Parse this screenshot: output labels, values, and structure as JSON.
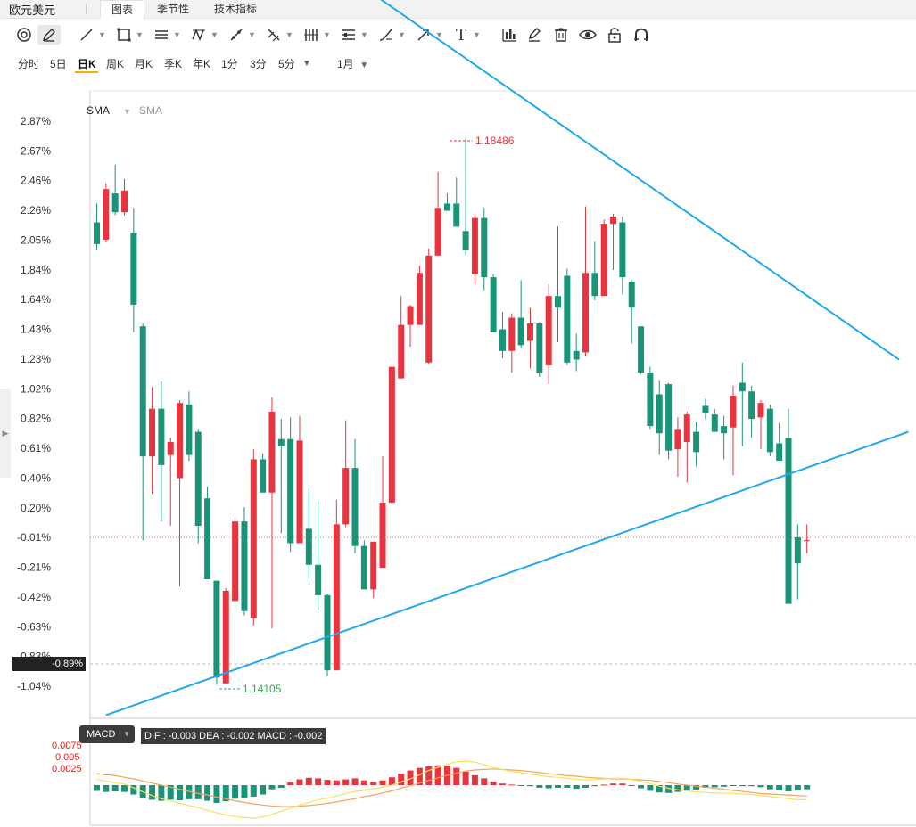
{
  "header": {
    "title": "欧元美元",
    "tabs": [
      {
        "label": "图表",
        "active": true
      },
      {
        "label": "季节性",
        "active": false
      },
      {
        "label": "技术指标",
        "active": false
      }
    ]
  },
  "toolbar": {
    "tools": [
      "loop-icon",
      "pencil-icon",
      "line-tool-icon",
      "rectangle-tool-icon",
      "parallel-lines-icon",
      "zigzag-icon",
      "ruler-icon",
      "fibonacci-icon",
      "bar-pattern-icon",
      "channel-icon",
      "brush-icon",
      "arrow-icon",
      "text-tool-icon",
      "candle-chart-icon",
      "edit-icon",
      "trash-icon",
      "eye-icon",
      "lock-icon",
      "magnet-icon"
    ],
    "text_tool_label": "T"
  },
  "periods": {
    "items": [
      "分时",
      "5日",
      "日K",
      "周K",
      "月K",
      "季K",
      "年K",
      "1分",
      "3分",
      "5分"
    ],
    "selected": "日K",
    "range_label": "1月"
  },
  "chart": {
    "sma_legend": [
      "SMA",
      "SMA"
    ],
    "crosshair_value": "-0.89%",
    "high_label": "1.18486",
    "low_label": "1.14105",
    "colors": {
      "up": "#e8343f",
      "down": "#1a9478",
      "trendline": "#1fa8ef",
      "accent": "#f2b300"
    }
  },
  "chart_data": {
    "type": "candlestick",
    "y_axis_ticks": [
      "2.87%",
      "2.67%",
      "2.46%",
      "2.26%",
      "2.05%",
      "1.84%",
      "1.64%",
      "1.43%",
      "1.23%",
      "1.02%",
      "0.82%",
      "0.61%",
      "0.40%",
      "0.20%",
      "-0.01%",
      "-0.21%",
      "-0.42%",
      "-0.63%",
      "-0.83%",
      "-1.04%"
    ],
    "candles": [
      {
        "o": 2.17,
        "c": 2.02,
        "h": 2.3,
        "l": 1.98
      },
      {
        "o": 2.05,
        "c": 2.4,
        "h": 2.44,
        "l": 2.03
      },
      {
        "o": 2.37,
        "c": 2.24,
        "h": 2.57,
        "l": 2.22
      },
      {
        "o": 2.24,
        "c": 2.39,
        "h": 2.47,
        "l": 2.22
      },
      {
        "o": 2.1,
        "c": 1.6,
        "h": 2.27,
        "l": 1.41
      },
      {
        "o": 1.45,
        "c": 0.55,
        "h": 1.47,
        "l": -0.03
      },
      {
        "o": 0.55,
        "c": 0.88,
        "h": 1.03,
        "l": 0.29
      },
      {
        "o": 0.88,
        "c": 0.49,
        "h": 1.07,
        "l": 0.1
      },
      {
        "o": 0.56,
        "c": 0.65,
        "h": 0.68,
        "l": 0.07
      },
      {
        "o": 0.4,
        "c": 0.92,
        "h": 0.94,
        "l": -0.35
      },
      {
        "o": 0.91,
        "c": 0.56,
        "h": 1.0,
        "l": 0.52
      },
      {
        "o": 0.72,
        "c": 0.07,
        "h": 0.74,
        "l": -0.05
      },
      {
        "o": 0.26,
        "c": -0.3,
        "h": 0.34,
        "l": -0.3
      },
      {
        "o": -0.31,
        "c": -0.98,
        "h": -0.31,
        "l": -1.03
      },
      {
        "o": -1.02,
        "c": -0.38,
        "h": -0.36,
        "l": -1.02
      },
      {
        "o": -0.45,
        "c": 0.1,
        "h": 0.13,
        "l": -0.45
      },
      {
        "o": 0.1,
        "c": -0.52,
        "h": 0.2,
        "l": -0.55
      },
      {
        "o": -0.57,
        "c": 0.53,
        "h": 0.6,
        "l": -0.62
      },
      {
        "o": 0.53,
        "c": 0.3,
        "h": 0.57,
        "l": 0.3
      },
      {
        "o": 0.3,
        "c": 0.86,
        "h": 0.96,
        "l": -0.64
      },
      {
        "o": 0.67,
        "c": 0.62,
        "h": 0.81,
        "l": 0.02
      },
      {
        "o": 0.67,
        "c": -0.05,
        "h": 0.82,
        "l": -0.11
      },
      {
        "o": -0.05,
        "c": 0.66,
        "h": 0.83,
        "l": -0.01
      },
      {
        "o": 0.05,
        "c": -0.2,
        "h": 0.33,
        "l": -0.3
      },
      {
        "o": -0.2,
        "c": -0.41,
        "h": 0.24,
        "l": -0.51
      },
      {
        "o": -0.41,
        "c": -0.93,
        "h": -0.4,
        "l": -0.97
      },
      {
        "o": -0.93,
        "c": 0.08,
        "h": 0.25,
        "l": -0.93
      },
      {
        "o": 0.08,
        "c": 0.47,
        "h": 0.8,
        "l": 0.06
      },
      {
        "o": 0.47,
        "c": -0.07,
        "h": 0.67,
        "l": -0.12
      },
      {
        "o": -0.07,
        "c": -0.37,
        "h": -0.03,
        "l": -0.37
      },
      {
        "o": -0.37,
        "c": -0.04,
        "h": -0.04,
        "l": -0.43
      },
      {
        "o": -0.22,
        "c": 0.23,
        "h": 0.55,
        "l": -0.22
      },
      {
        "o": 0.23,
        "c": 1.17,
        "h": 1.17,
        "l": 0.22
      },
      {
        "o": 1.09,
        "c": 1.46,
        "h": 1.66,
        "l": 1.09
      },
      {
        "o": 1.46,
        "c": 1.59,
        "h": 1.6,
        "l": 1.31
      },
      {
        "o": 1.46,
        "c": 1.82,
        "h": 1.87,
        "l": 1.46
      },
      {
        "o": 1.2,
        "c": 1.94,
        "h": 1.99,
        "l": 1.19
      },
      {
        "o": 1.94,
        "c": 2.27,
        "h": 2.52,
        "l": 1.94
      },
      {
        "o": 2.3,
        "c": 2.25,
        "h": 2.37,
        "l": 2.25
      },
      {
        "o": 2.3,
        "c": 2.14,
        "h": 2.48,
        "l": 2.14
      },
      {
        "o": 2.11,
        "c": 1.98,
        "h": 2.75,
        "l": 1.94
      },
      {
        "o": 1.81,
        "c": 2.2,
        "h": 2.23,
        "l": 1.74
      },
      {
        "o": 2.2,
        "c": 1.79,
        "h": 2.27,
        "l": 1.7
      },
      {
        "o": 1.79,
        "c": 1.41,
        "h": 1.81,
        "l": 1.41
      },
      {
        "o": 1.43,
        "c": 1.28,
        "h": 1.55,
        "l": 1.23
      },
      {
        "o": 1.28,
        "c": 1.51,
        "h": 1.54,
        "l": 1.13
      },
      {
        "o": 1.51,
        "c": 1.32,
        "h": 1.77,
        "l": 1.3
      },
      {
        "o": 1.35,
        "c": 1.47,
        "h": 1.58,
        "l": 1.16
      },
      {
        "o": 1.47,
        "c": 1.13,
        "h": 1.48,
        "l": 1.1
      },
      {
        "o": 1.18,
        "c": 1.66,
        "h": 1.74,
        "l": 1.05
      },
      {
        "o": 1.66,
        "c": 1.58,
        "h": 2.14,
        "l": 1.34
      },
      {
        "o": 1.8,
        "c": 1.2,
        "h": 1.85,
        "l": 1.18
      },
      {
        "o": 1.28,
        "c": 1.22,
        "h": 1.4,
        "l": 1.14
      },
      {
        "o": 1.27,
        "c": 1.82,
        "h": 2.28,
        "l": 1.24
      },
      {
        "o": 1.82,
        "c": 1.66,
        "h": 2.04,
        "l": 1.63
      },
      {
        "o": 1.66,
        "c": 2.16,
        "h": 2.19,
        "l": 1.66
      },
      {
        "o": 2.16,
        "c": 2.21,
        "h": 2.23,
        "l": 1.84
      },
      {
        "o": 2.17,
        "c": 1.79,
        "h": 2.21,
        "l": 1.67
      },
      {
        "o": 1.76,
        "c": 1.58,
        "h": 1.77,
        "l": 1.33
      },
      {
        "o": 1.45,
        "c": 1.13,
        "h": 1.45,
        "l": 1.12
      },
      {
        "o": 1.13,
        "c": 0.76,
        "h": 1.17,
        "l": 0.74
      },
      {
        "o": 0.98,
        "c": 0.71,
        "h": 1.08,
        "l": 0.56
      },
      {
        "o": 1.05,
        "c": 0.59,
        "h": 1.06,
        "l": 0.53
      },
      {
        "o": 0.6,
        "c": 0.74,
        "h": 0.82,
        "l": 0.41
      },
      {
        "o": 0.65,
        "c": 0.84,
        "h": 0.86,
        "l": 0.37
      },
      {
        "o": 0.72,
        "c": 0.58,
        "h": 0.79,
        "l": 0.48
      },
      {
        "o": 0.9,
        "c": 0.85,
        "h": 0.95,
        "l": 0.81
      },
      {
        "o": 0.84,
        "c": 0.72,
        "h": 0.88,
        "l": 0.73
      },
      {
        "o": 0.76,
        "c": 0.71,
        "h": 0.83,
        "l": 0.53
      },
      {
        "o": 0.75,
        "c": 0.97,
        "h": 1.04,
        "l": 0.42
      },
      {
        "o": 1.06,
        "c": 1.0,
        "h": 1.2,
        "l": 0.62
      },
      {
        "o": 1.0,
        "c": 0.81,
        "h": 1.04,
        "l": 0.68
      },
      {
        "o": 0.82,
        "c": 0.92,
        "h": 0.94,
        "l": 0.6
      },
      {
        "o": 0.88,
        "c": 0.58,
        "h": 0.91,
        "l": 0.55
      },
      {
        "o": 0.64,
        "c": 0.52,
        "h": 0.78,
        "l": 0.54
      },
      {
        "o": 0.68,
        "c": -0.47,
        "h": 0.88,
        "l": -0.47
      },
      {
        "o": -0.01,
        "c": -0.19,
        "h": 0.08,
        "l": -0.44
      },
      {
        "o": -0.03,
        "c": -0.03,
        "h": 0.08,
        "l": -0.12
      }
    ],
    "price_extremes": {
      "high": 1.18486,
      "low": 1.14105
    },
    "trendlines": [
      {
        "from": {
          "i": 25,
          "v": 3.97
        },
        "to": {
          "i": 87,
          "v": 1.22
        }
      },
      {
        "from": {
          "i": 1,
          "v": -1.24
        },
        "to": {
          "i": 88,
          "v": 0.72
        }
      }
    ],
    "reference_line_value": -0.01,
    "macd": {
      "label": "MACD",
      "readout": "DIF : -0.003   DEA : -0.002   MACD : -0.002",
      "y_ticks": [
        "0.0075",
        "0.005",
        "0.0025"
      ],
      "histogram": [
        -0.0011,
        -0.0013,
        -0.0012,
        -0.0013,
        -0.0018,
        -0.0024,
        -0.0028,
        -0.003,
        -0.0028,
        -0.0029,
        -0.0027,
        -0.0027,
        -0.003,
        -0.0034,
        -0.0031,
        -0.0026,
        -0.0025,
        -0.0022,
        -0.0018,
        -0.0008,
        -0.0005,
        0.0005,
        0.0011,
        0.0014,
        0.0013,
        0.001,
        0.0009,
        0.0011,
        0.0013,
        0.0009,
        0.0006,
        0.0009,
        0.0015,
        0.0022,
        0.0028,
        0.0033,
        0.0036,
        0.0038,
        0.0037,
        0.0033,
        0.0026,
        0.0019,
        0.0013,
        0.0007,
        0.0003,
        0.0001,
        0.0,
        -0.0002,
        -0.0005,
        -0.0006,
        -0.0005,
        -0.0005,
        -0.0007,
        -0.0005,
        -0.0002,
        0.0001,
        0.0003,
        0.0003,
        -0.0001,
        -0.0006,
        -0.0011,
        -0.0014,
        -0.0015,
        -0.0013,
        -0.0011,
        -0.0009,
        -0.0005,
        -0.0004,
        -0.0003,
        -0.0001,
        -0.0002,
        -0.0002,
        -0.0004,
        -0.0008,
        -0.001,
        -0.0012,
        -0.001,
        -0.0008
      ],
      "dif": [
        0.0011,
        0.0008,
        0.0005,
        0.0002,
        -0.0005,
        -0.0013,
        -0.002,
        -0.0026,
        -0.003,
        -0.0035,
        -0.0039,
        -0.0043,
        -0.0048,
        -0.0053,
        -0.0057,
        -0.006,
        -0.0062,
        -0.0063,
        -0.0061,
        -0.0056,
        -0.005,
        -0.0044,
        -0.0038,
        -0.0033,
        -0.0028,
        -0.0025,
        -0.0021,
        -0.0016,
        -0.0012,
        -0.001,
        -0.0007,
        -0.0004,
        0.0,
        0.0006,
        0.0012,
        0.002,
        0.0028,
        0.0034,
        0.004,
        0.0045,
        0.0046,
        0.0044,
        0.0039,
        0.0034,
        0.003,
        0.0026,
        0.0024,
        0.0021,
        0.0018,
        0.0016,
        0.0015,
        0.0013,
        0.0011,
        0.001,
        0.0011,
        0.0012,
        0.0013,
        0.0013,
        0.0011,
        0.0007,
        0.0003,
        -0.0002,
        -0.0006,
        -0.0009,
        -0.0011,
        -0.0013,
        -0.0014,
        -0.0015,
        -0.0015,
        -0.0016,
        -0.0017,
        -0.0018,
        -0.002,
        -0.0022,
        -0.0024,
        -0.0026,
        -0.0028,
        -0.0028
      ],
      "dea": [
        0.0022,
        0.002,
        0.0018,
        0.0015,
        0.0012,
        0.0008,
        0.0004,
        0.0,
        -0.0004,
        -0.0008,
        -0.0012,
        -0.0016,
        -0.0019,
        -0.0023,
        -0.0026,
        -0.003,
        -0.0033,
        -0.0036,
        -0.0038,
        -0.004,
        -0.0041,
        -0.0041,
        -0.004,
        -0.0039,
        -0.0037,
        -0.0035,
        -0.0032,
        -0.0029,
        -0.0026,
        -0.0022,
        -0.0019,
        -0.0015,
        -0.0011,
        -0.0006,
        -0.0001,
        0.0004,
        0.0009,
        0.0014,
        0.0019,
        0.0023,
        0.0027,
        0.0029,
        0.003,
        0.0031,
        0.003,
        0.0029,
        0.0028,
        0.0026,
        0.0024,
        0.0022,
        0.002,
        0.0018,
        0.0017,
        0.0015,
        0.0014,
        0.0013,
        0.0012,
        0.0012,
        0.0011,
        0.001,
        0.0009,
        0.0007,
        0.0005,
        0.0002,
        0.0,
        -0.0002,
        -0.0004,
        -0.0006,
        -0.0008,
        -0.001,
        -0.0012,
        -0.0014,
        -0.0016,
        -0.0017,
        -0.0018,
        -0.0019,
        -0.002,
        -0.0021
      ]
    }
  }
}
